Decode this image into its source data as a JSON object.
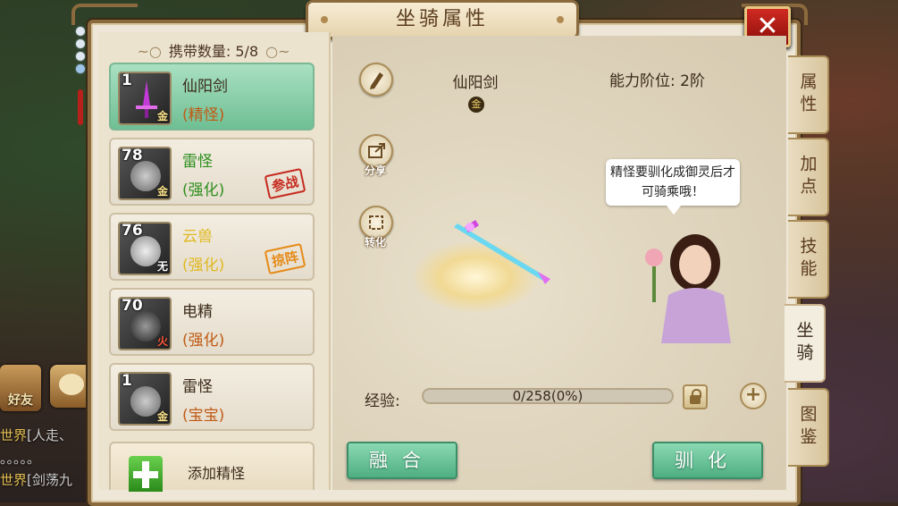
{
  "window": {
    "title": "坐骑属性",
    "close_label": "✕"
  },
  "list": {
    "carry_label": "携带数量:",
    "carry_value": "5/8",
    "items": [
      {
        "level": "1",
        "grade": "金",
        "name": "仙阳剑",
        "quality": "(精怪)",
        "tag": "",
        "kind": "sword"
      },
      {
        "level": "78",
        "grade": "金",
        "name": "雷怪",
        "quality": "(强化)",
        "tag": "参战",
        "kind": "beast"
      },
      {
        "level": "76",
        "grade": "无",
        "name": "云兽",
        "quality": "(强化)",
        "tag": "掠阵",
        "kind": "beast"
      },
      {
        "level": "70",
        "grade": "火",
        "name": "电精",
        "quality": "(强化)",
        "tag": "",
        "kind": "beast"
      },
      {
        "level": "1",
        "grade": "金",
        "name": "雷怪",
        "quality": "(宝宝)",
        "tag": "",
        "kind": "beast"
      }
    ],
    "add_label": "添加精怪"
  },
  "detail": {
    "mount_name": "仙阳剑",
    "grade_badge": "金",
    "ability_label": "能力阶位:",
    "ability_value": "2阶",
    "share_label": "分享",
    "convert_label": "转化",
    "speech": "精怪要驯化成御灵后才可骑乘哦！",
    "exp_label": "经验:",
    "exp_text": "0/258(0%)",
    "exp_fraction": 0,
    "plus_label": "+",
    "fuse_label": "融合",
    "tame_label": "驯化"
  },
  "tabs": [
    {
      "label": "属性",
      "active": false
    },
    {
      "label": "加点",
      "active": false
    },
    {
      "label": "技能",
      "active": false
    },
    {
      "label": "坐骑",
      "active": true
    },
    {
      "label": "图鉴",
      "active": false
    }
  ],
  "chat": {
    "friend_label": "好友",
    "lines": [
      {
        "channel": "世界",
        "text": "[人走、"
      },
      {
        "channel": "",
        "text": "。。。。。"
      },
      {
        "channel": "世界",
        "text": "[剑荡九"
      }
    ]
  },
  "colors": {
    "accent_green": "#6fbf94",
    "frame_brown": "#8b6a3e",
    "quality_orange": "#c05a14"
  }
}
